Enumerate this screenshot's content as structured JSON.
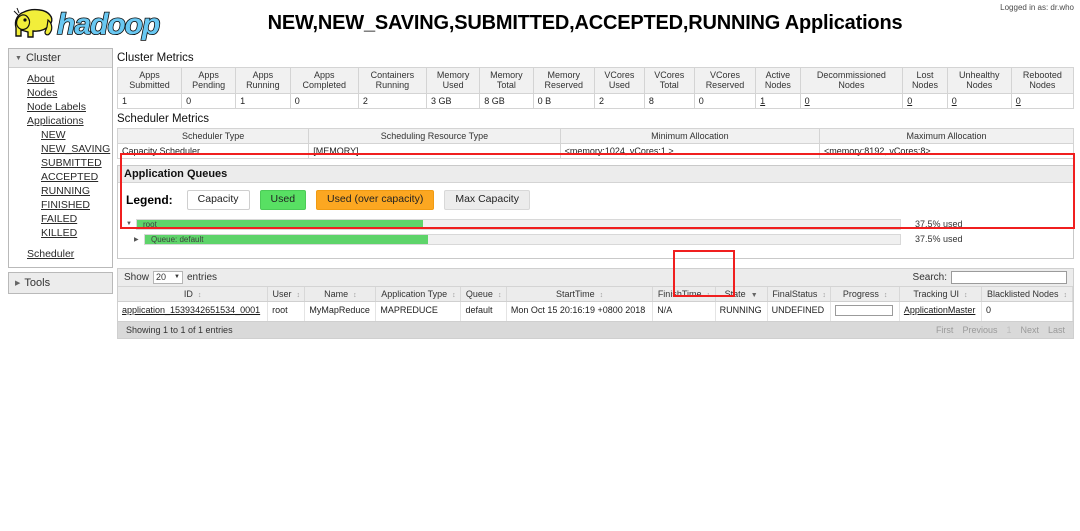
{
  "header": {
    "logo_alt": "hadoop",
    "title": "NEW,NEW_SAVING,SUBMITTED,ACCEPTED,RUNNING Applications",
    "logged_in": "Logged in as: dr.who"
  },
  "sidebar": {
    "cluster_label": "Cluster",
    "tools_label": "Tools",
    "items": [
      {
        "label": "About",
        "indent": false
      },
      {
        "label": "Nodes",
        "indent": false
      },
      {
        "label": "Node Labels",
        "indent": false
      },
      {
        "label": "Applications",
        "indent": false
      },
      {
        "label": "NEW",
        "indent": true
      },
      {
        "label": "NEW_SAVING",
        "indent": true
      },
      {
        "label": "SUBMITTED",
        "indent": true
      },
      {
        "label": "ACCEPTED",
        "indent": true
      },
      {
        "label": "RUNNING",
        "indent": true
      },
      {
        "label": "FINISHED",
        "indent": true
      },
      {
        "label": "FAILED",
        "indent": true
      },
      {
        "label": "KILLED",
        "indent": true
      },
      {
        "label": "Scheduler",
        "indent": false,
        "spaced": true
      }
    ]
  },
  "cluster_metrics": {
    "title": "Cluster Metrics",
    "headers": [
      "Apps\nSubmitted",
      "Apps\nPending",
      "Apps\nRunning",
      "Apps\nCompleted",
      "Containers\nRunning",
      "Memory\nUsed",
      "Memory\nTotal",
      "Memory\nReserved",
      "VCores\nUsed",
      "VCores\nTotal",
      "VCores\nReserved",
      "Active\nNodes",
      "Decommissioned\nNodes",
      "Lost\nNodes",
      "Unhealthy\nNodes",
      "Rebooted\nNodes"
    ],
    "values": [
      "1",
      "0",
      "1",
      "0",
      "2",
      "3 GB",
      "8 GB",
      "0 B",
      "2",
      "8",
      "0",
      "1",
      "0",
      "0",
      "0",
      "0"
    ],
    "link_flags": [
      false,
      false,
      false,
      false,
      false,
      false,
      false,
      false,
      false,
      false,
      false,
      true,
      true,
      true,
      true,
      true
    ]
  },
  "scheduler_metrics": {
    "title": "Scheduler Metrics",
    "headers": [
      "Scheduler Type",
      "Scheduling Resource Type",
      "Minimum Allocation",
      "Maximum Allocation"
    ],
    "values": [
      "Capacity Scheduler",
      "[MEMORY]",
      "<memory:1024, vCores:1 >",
      "<memory:8192, vCores:8>"
    ]
  },
  "queues": {
    "title": "Application Queues",
    "legend_label": "Legend:",
    "legend": [
      {
        "label": "Capacity",
        "style": "capacity"
      },
      {
        "label": "Used",
        "style": "used"
      },
      {
        "label": "Used (over capacity)",
        "style": "over"
      },
      {
        "label": "Max Capacity",
        "style": "maxcap"
      }
    ],
    "rows": [
      {
        "label": "root",
        "used_pct": 37.5,
        "used_text": "37.5% used",
        "level": 0
      },
      {
        "label": "Queue: default",
        "used_pct": 37.5,
        "used_text": "37.5% used",
        "level": 1
      }
    ]
  },
  "apps_table": {
    "show_label": "Show",
    "entries_label": "entries",
    "page_size": "20",
    "search_label": "Search:",
    "search_value": "",
    "search_placeholder": "",
    "headers": [
      "ID",
      "User",
      "Name",
      "Application Type",
      "Queue",
      "StartTime",
      "FinishTime",
      "State",
      "FinalStatus",
      "Progress",
      "Tracking UI",
      "Blacklisted Nodes"
    ],
    "sorted_column": "State",
    "rows": [
      {
        "id": "application_1539342651534_0001",
        "user": "root",
        "name": "MyMapReduce",
        "app_type": "MAPREDUCE",
        "queue": "default",
        "start_time": "Mon Oct 15 20:16:19 +0800 2018",
        "finish_time": "N/A",
        "state": "RUNNING",
        "final_status": "UNDEFINED",
        "progress": 0,
        "tracking_ui": "ApplicationMaster",
        "blacklisted_nodes": "0"
      }
    ],
    "footer_info": "Showing 1 to 1 of 1 entries",
    "pager": [
      "First",
      "Previous",
      "1",
      "Next",
      "Last"
    ]
  },
  "annotations": {
    "color": "#f01f1f",
    "boxes": [
      "application-queues-panel",
      "state-column-running"
    ]
  },
  "colors": {
    "used_green": "#5ed46a",
    "over_orange": "#fca721",
    "annotation_red": "#f01f1f",
    "header_gray": "#ececec"
  }
}
